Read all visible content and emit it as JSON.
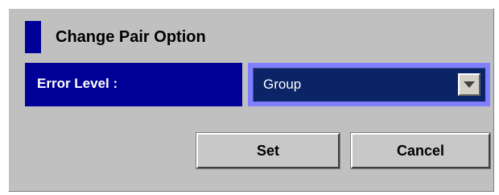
{
  "dialog": {
    "title": "Change Pair Option",
    "error_level": {
      "label": "Error Level :",
      "selected": "Group"
    },
    "buttons": {
      "set": "Set",
      "cancel": "Cancel"
    }
  },
  "colors": {
    "background": "#c0c0c0",
    "label_bg": "#000099",
    "select_bg": "#0a2466",
    "focus_border": "#7f7fff"
  }
}
